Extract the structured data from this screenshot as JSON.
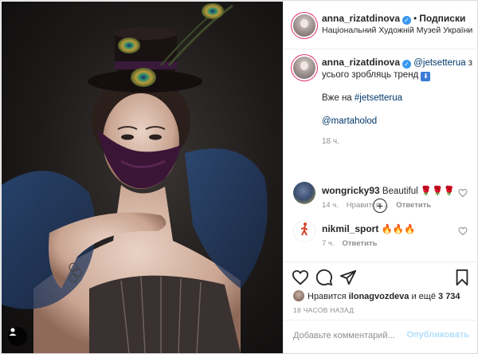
{
  "post": {
    "author": "anna_rizatdinova",
    "verified": true,
    "follow_label": "Подписки",
    "location": "Національний Художній Музей України"
  },
  "caption": {
    "author": "anna_rizatdinova",
    "mention1": "@jetsetterua",
    "text1": " з усього зробляць тренд ",
    "line2_prefix": "Вже на ",
    "hashtag": "#jetsetterua",
    "mention2": "@martaholod",
    "time": "18 ч."
  },
  "comments": [
    {
      "author": "wongricky93",
      "text": "Beautiful",
      "emoji": "🌹🌹🌹",
      "time": "14 ч.",
      "likes": "Нравится: 1",
      "reply": "Ответить"
    },
    {
      "author": "nikmil_sport",
      "text": "",
      "emoji": "🔥🔥🔥",
      "time": "7 ч.",
      "likes": "",
      "reply": "Ответить"
    }
  ],
  "likes": {
    "prefix": "Нравится ",
    "user": "ilonagvozdeva",
    "middle": " и ещё ",
    "count": "3 734"
  },
  "post_time": "18 ЧАСОВ НАЗАД",
  "comment_input": {
    "placeholder": "Добавьте комментарий..."
  },
  "publish_label": "Опубликовать",
  "icons": {
    "like": "heart-icon",
    "comment": "comment-icon",
    "share": "share-icon",
    "save": "bookmark-icon",
    "load_more": "plus-circle-icon",
    "user_tag": "user-tag-icon"
  },
  "colors": {
    "link": "#00376b",
    "verified": "#3897f0",
    "publish_disabled": "#b2dffc",
    "muted": "#8e8e8e"
  }
}
